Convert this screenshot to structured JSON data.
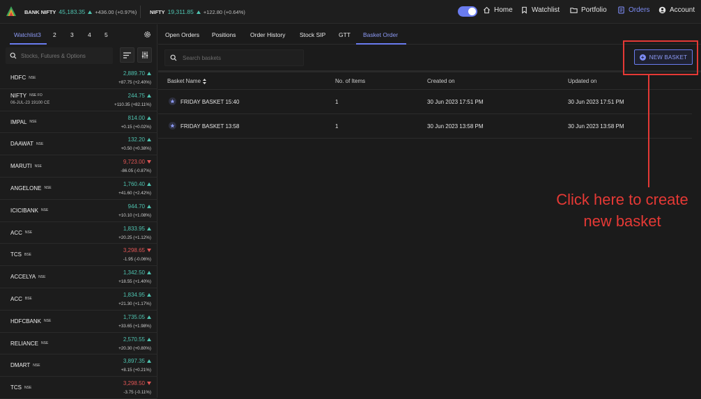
{
  "header": {
    "tickers": [
      {
        "name": "BANK NIFTY",
        "price": "45,183.35",
        "change": "+436.00 (+0.97%)"
      },
      {
        "name": "NIFTY",
        "price": "19,311.85",
        "change": "+122.80 (+0.64%)"
      }
    ],
    "nav": [
      {
        "label": "Home",
        "icon": "home-icon"
      },
      {
        "label": "Watchlist",
        "icon": "bookmark-icon"
      },
      {
        "label": "Portfolio",
        "icon": "folder-icon"
      },
      {
        "label": "Orders",
        "icon": "orders-icon",
        "active": true
      },
      {
        "label": "Account",
        "icon": "account-icon"
      }
    ],
    "accent": "#6a7cf0"
  },
  "watchlist": {
    "tabs": [
      "Watchlist3",
      "2",
      "3",
      "4",
      "5"
    ],
    "search_placeholder": "Stocks, Futures & Options",
    "items": [
      {
        "symbol": "HDFC",
        "exchange": "NSE",
        "sub": "",
        "price": "2,889.70",
        "change": "+87.75 (+2.40%)",
        "dir": "up"
      },
      {
        "symbol": "NIFTY",
        "exchange": "NSE FO",
        "sub": "06-JUL-23 19100 CE",
        "price": "244.75",
        "change": "+110.35 (+82.11%)",
        "dir": "up"
      },
      {
        "symbol": "IMPAL",
        "exchange": "NSE",
        "sub": "",
        "price": "814.00",
        "change": "+0.15 (+0.02%)",
        "dir": "up"
      },
      {
        "symbol": "DAAWAT",
        "exchange": "NSE",
        "sub": "",
        "price": "132.20",
        "change": "+0.50 (+0.38%)",
        "dir": "up"
      },
      {
        "symbol": "MARUTI",
        "exchange": "NSE",
        "sub": "",
        "price": "9,723.00",
        "change": "-86.05 (-0.87%)",
        "dir": "down"
      },
      {
        "symbol": "ANGELONE",
        "exchange": "NSE",
        "sub": "",
        "price": "1,760.40",
        "change": "+41.60 (+2.42%)",
        "dir": "up"
      },
      {
        "symbol": "ICICIBANK",
        "exchange": "NSE",
        "sub": "",
        "price": "944.70",
        "change": "+10.10 (+1.08%)",
        "dir": "up"
      },
      {
        "symbol": "ACC",
        "exchange": "NSE",
        "sub": "",
        "price": "1,833.95",
        "change": "+20.25 (+1.12%)",
        "dir": "up"
      },
      {
        "symbol": "TCS",
        "exchange": "BSE",
        "sub": "",
        "price": "3,298.65",
        "change": "-1.95 (-0.06%)",
        "dir": "down"
      },
      {
        "symbol": "ACCELYA",
        "exchange": "NSE",
        "sub": "",
        "price": "1,342.50",
        "change": "+18.55 (+1.40%)",
        "dir": "up"
      },
      {
        "symbol": "ACC",
        "exchange": "BSE",
        "sub": "",
        "price": "1,834.95",
        "change": "+21.30 (+1.17%)",
        "dir": "up"
      },
      {
        "symbol": "HDFCBANK",
        "exchange": "NSE",
        "sub": "",
        "price": "1,735.05",
        "change": "+33.65 (+1.98%)",
        "dir": "up"
      },
      {
        "symbol": "RELIANCE",
        "exchange": "NSE",
        "sub": "",
        "price": "2,570.55",
        "change": "+20.30 (+0.80%)",
        "dir": "up"
      },
      {
        "symbol": "DMART",
        "exchange": "NSE",
        "sub": "",
        "price": "3,897.35",
        "change": "+8.15 (+0.21%)",
        "dir": "up"
      },
      {
        "symbol": "TCS",
        "exchange": "NSE",
        "sub": "",
        "price": "3,298.50",
        "change": "-3.75 (-0.11%)",
        "dir": "down"
      }
    ]
  },
  "orders": {
    "tabs": [
      "Open Orders",
      "Positions",
      "Order History",
      "Stock SIP",
      "GTT",
      "Basket Order"
    ],
    "active_tab": "Basket Order",
    "search_placeholder": "Search baskets",
    "new_basket_label": "NEW BASKET",
    "columns": [
      "Basket Name",
      "No. of Items",
      "Created on",
      "Updated on"
    ],
    "rows": [
      {
        "name": "FRIDAY BASKET 15:40",
        "items": "1",
        "created": "30 Jun 2023 17:51 PM",
        "updated": "30 Jun 2023 17:51 PM"
      },
      {
        "name": "FRIDAY BASKET 13:58",
        "items": "1",
        "created": "30 Jun 2023 13:58 PM",
        "updated": "30 Jun 2023 13:58 PM"
      }
    ]
  },
  "annotation": {
    "text": "Click here to create\nnew basket",
    "color": "#e53935"
  }
}
